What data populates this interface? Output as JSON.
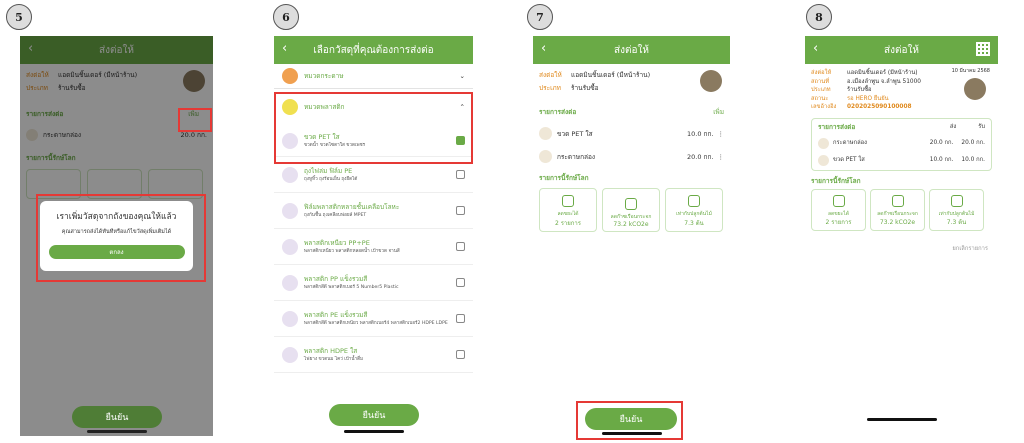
{
  "steps": [
    "5",
    "6",
    "7",
    "8"
  ],
  "s5": {
    "title": "ส่งต่อให้",
    "to_label": "ส่งต่อให้",
    "to_value": "แอดมินชิ้นเดอร์ (มีหน้าร้าน)",
    "type_label": "ประเภท",
    "type_value": "ร้านรับซื้อ",
    "list_label": "รายการส่งต่อ",
    "add_label": "เพิ่ม",
    "item": "กระดาษกล่อง",
    "item_qty": "20.0 กก.",
    "save_label": "รายการนี้รักษ์โลก",
    "modal_title": "เราเพิ่มวัสดุจากถังของคุณให้แล้ว",
    "modal_text": "คุณสามารถส่งได้ทันทีหรือแก้ไขวัสดุเพิ่มเติมได้",
    "modal_ok": "ตกลง",
    "confirm": "ยืนยัน"
  },
  "s6": {
    "title": "เลือกวัสดุที่คุณต้องการส่งต่อ",
    "cat1": "หมวดกระดาษ",
    "cat2": "หมวดพลาสติก",
    "items": [
      {
        "name": "ขวด PET ใส",
        "desc": "ขวดน้ำ ขวดโซดาใส ขวดเพชร",
        "checked": true
      },
      {
        "name": "ถุงไฟล่ม ฟิล์ม PE",
        "desc": "ถุงหูหิ้ว ถุงร้อนเย็น ถุงยืดได้",
        "checked": false
      },
      {
        "name": "ฟิล์มพลาสติกหลายชั้นเคลือบโลหะ",
        "desc": "ถุงกันชื้น ถุงเคลือบฟอยล์ MPET",
        "checked": false
      },
      {
        "name": "พลาสติกเหนียว PP+PE",
        "desc": "พลาสติกเหนียว พลาสติกหลอดน้ำ เป้าขวด จานสี",
        "checked": false
      },
      {
        "name": "พลาสติก PP แข็งรวมสี",
        "desc": "พลาสติกสีดี พลาสติกเบอร์ 5 Number5 Plastic",
        "checked": false
      },
      {
        "name": "พลาสติก PE แข็งรวมสี",
        "desc": "พลาสติกสีดี พลาสติกเหนียว พลาสติกเบอร์4 พลาสติกเบอร์2 HDPE LDPE",
        "checked": false
      },
      {
        "name": "พลาสติก HDPE ใส",
        "desc": "ไฟยาง ขวดนม ไคว่ เป้าน้ำดื่ม",
        "checked": false
      }
    ],
    "confirm": "ยืนยัน"
  },
  "s7": {
    "title": "ส่งต่อให้",
    "to_label": "ส่งต่อให้",
    "to_value": "แอดมินชิ้นเดอร์ (มีหน้าร้าน)",
    "type_label": "ประเภท",
    "type_value": "ร้านรับซื้อ",
    "list_label": "รายการส่งต่อ",
    "add_label": "เพิ่ม",
    "items": [
      {
        "name": "ขวด PET ใส",
        "qty": "10.0 กก."
      },
      {
        "name": "กระดาษกล่อง",
        "qty": "20.0 กก."
      }
    ],
    "save_label": "รายการนี้รักษ์โลก",
    "stats": [
      {
        "label": "ลดขยะได้",
        "value": "2 รายการ"
      },
      {
        "label": "ลดก๊าซเรือนกระจก",
        "value": "73.2 kCO2e"
      },
      {
        "label": "เท่ากับปลูกต้นไม้",
        "value": "7.3 ต้น"
      }
    ],
    "confirm": "ยืนยัน"
  },
  "s8": {
    "title": "ส่งต่อให้",
    "date": "10 มีนาคม 2568",
    "to_label": "ส่งต่อให้",
    "to_value": "แอดมินชิ้นเดอร์ (มีหน้าร้าน)",
    "loc_label": "สถานที่",
    "loc_value": "อ.เมืองลำพูน จ.ลำพูน 51000",
    "type_label": "ประเภท",
    "type_value": "ร้านรับซื้อ",
    "status_label": "สถานะ",
    "status_value": "รอ HERO ยืนยัน",
    "ref_label": "เลขอ้างอิง",
    "ref_value": "0202025090100008",
    "list_label": "รายการส่งต่อ",
    "col_sent": "ส่ง",
    "col_recv": "รับ",
    "items": [
      {
        "name": "กระดาษกล่อง",
        "sent": "20.0 กก.",
        "recv": "20.0 กก."
      },
      {
        "name": "ขวด PET ใส",
        "sent": "10.0 กก.",
        "recv": "10.0 กก."
      }
    ],
    "save_label": "รายการนี้รักษ์โลก",
    "stats": [
      {
        "label": "ลดขยะได้",
        "value": "2 รายการ"
      },
      {
        "label": "ลดก๊าซเรือนกระจก",
        "value": "73.2 kCO2e"
      },
      {
        "label": "เท่ากับปลูกต้นไม้",
        "value": "7.3 ต้น"
      }
    ],
    "cancel": "ยกเลิกรายการ"
  },
  "colors": {
    "green": "#6aaa46",
    "red": "#e53935",
    "orange": "#e08a1e"
  }
}
